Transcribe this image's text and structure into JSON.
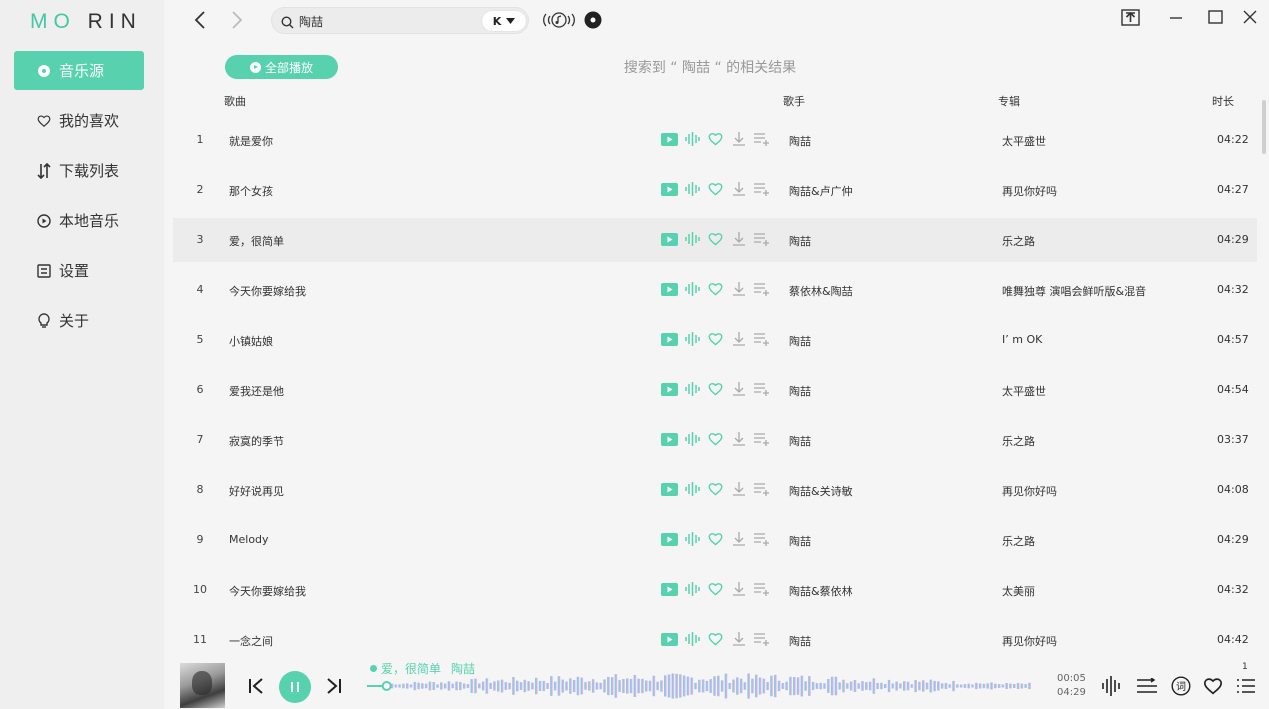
{
  "app": {
    "logo_a": "MO",
    "logo_b": "RIN"
  },
  "sidebar": {
    "items": [
      {
        "label": "音乐源",
        "icon": "disc-icon",
        "active": true
      },
      {
        "label": "我的喜欢",
        "icon": "heart-icon"
      },
      {
        "label": "下载列表",
        "icon": "sort-arrows-icon"
      },
      {
        "label": "本地音乐",
        "icon": "play-circle-icon"
      },
      {
        "label": "设置",
        "icon": "settings-icon"
      },
      {
        "label": "关于",
        "icon": "lightbulb-icon"
      }
    ]
  },
  "search": {
    "value": "陶喆",
    "source": "K"
  },
  "content": {
    "play_all": "全部播放",
    "result_title": "搜索到 “ 陶喆 “ 的相关结果",
    "columns": {
      "song": "歌曲",
      "singer": "歌手",
      "album": "专辑",
      "duration": "时长"
    }
  },
  "songs": [
    {
      "idx": "1",
      "title": "就是爱你",
      "singer": "陶喆",
      "album": "太平盛世",
      "duration": "04:22"
    },
    {
      "idx": "2",
      "title": "那个女孩",
      "singer": "陶喆&卢广仲",
      "album": "再见你好吗",
      "duration": "04:27"
    },
    {
      "idx": "3",
      "title": "爱，很简单",
      "singer": "陶喆",
      "album": "乐之路",
      "duration": "04:29"
    },
    {
      "idx": "4",
      "title": "今天你要嫁给我",
      "singer": "蔡依林&陶喆",
      "album": "唯舞独尊 演唱会鲜听版&混音",
      "duration": "04:32"
    },
    {
      "idx": "5",
      "title": "小镇姑娘",
      "singer": "陶喆",
      "album": "I’ m OK",
      "duration": "04:57"
    },
    {
      "idx": "6",
      "title": "爱我还是他",
      "singer": "陶喆",
      "album": "太平盛世",
      "duration": "04:54"
    },
    {
      "idx": "7",
      "title": "寂寞的季节",
      "singer": "陶喆",
      "album": "乐之路",
      "duration": "03:37"
    },
    {
      "idx": "8",
      "title": "好好说再见",
      "singer": "陶喆&关诗敏",
      "album": "再见你好吗",
      "duration": "04:08"
    },
    {
      "idx": "9",
      "title": "Melody",
      "singer": "陶喆",
      "album": "乐之路",
      "duration": "04:29"
    },
    {
      "idx": "10",
      "title": "今天你要嫁给我",
      "singer": "陶喆&蔡依林",
      "album": "太美丽",
      "duration": "04:32"
    },
    {
      "idx": "11",
      "title": "一念之间",
      "singer": "陶喆",
      "album": "再见你好吗",
      "duration": "04:42"
    }
  ],
  "player": {
    "song": "爱，很简单",
    "artist": "陶喆",
    "current_time": "00:05",
    "total_time": "04:29",
    "playlist_count": "1",
    "progress": 0.02
  },
  "colors": {
    "accent": "#58d2ae",
    "wave_start": "#7fd8d0",
    "wave_mid": "#a7b8f0",
    "wave_end": "#f0b8e6"
  }
}
